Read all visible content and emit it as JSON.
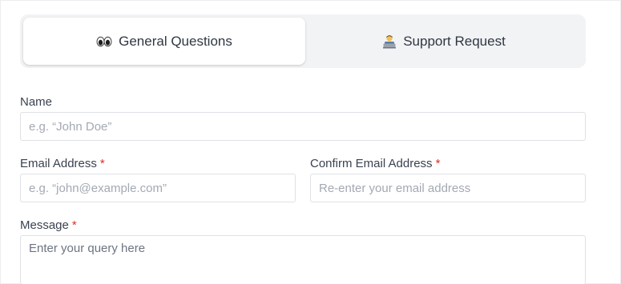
{
  "tabs": [
    {
      "label": "General Questions",
      "icon": "eyes-icon",
      "active": true
    },
    {
      "label": "Support Request",
      "icon": "technologist-icon",
      "active": false
    }
  ],
  "form": {
    "name": {
      "label": "Name",
      "placeholder": "e.g. “John Doe”",
      "required": false
    },
    "email": {
      "label": "Email Address",
      "placeholder": "e.g. “john@example.com”",
      "required": true
    },
    "confirm_email": {
      "label": "Confirm Email Address",
      "placeholder": "Re-enter your email address",
      "required": true
    },
    "message": {
      "label": "Message",
      "placeholder": "Enter your query here",
      "required": true
    },
    "required_marker": "*"
  },
  "colors": {
    "required": "#e02b27",
    "tab_bar_bg": "#f2f3f5",
    "active_tab_bg": "#ffffff",
    "input_border": "#dfe1e6",
    "placeholder": "#a3a9b3"
  }
}
